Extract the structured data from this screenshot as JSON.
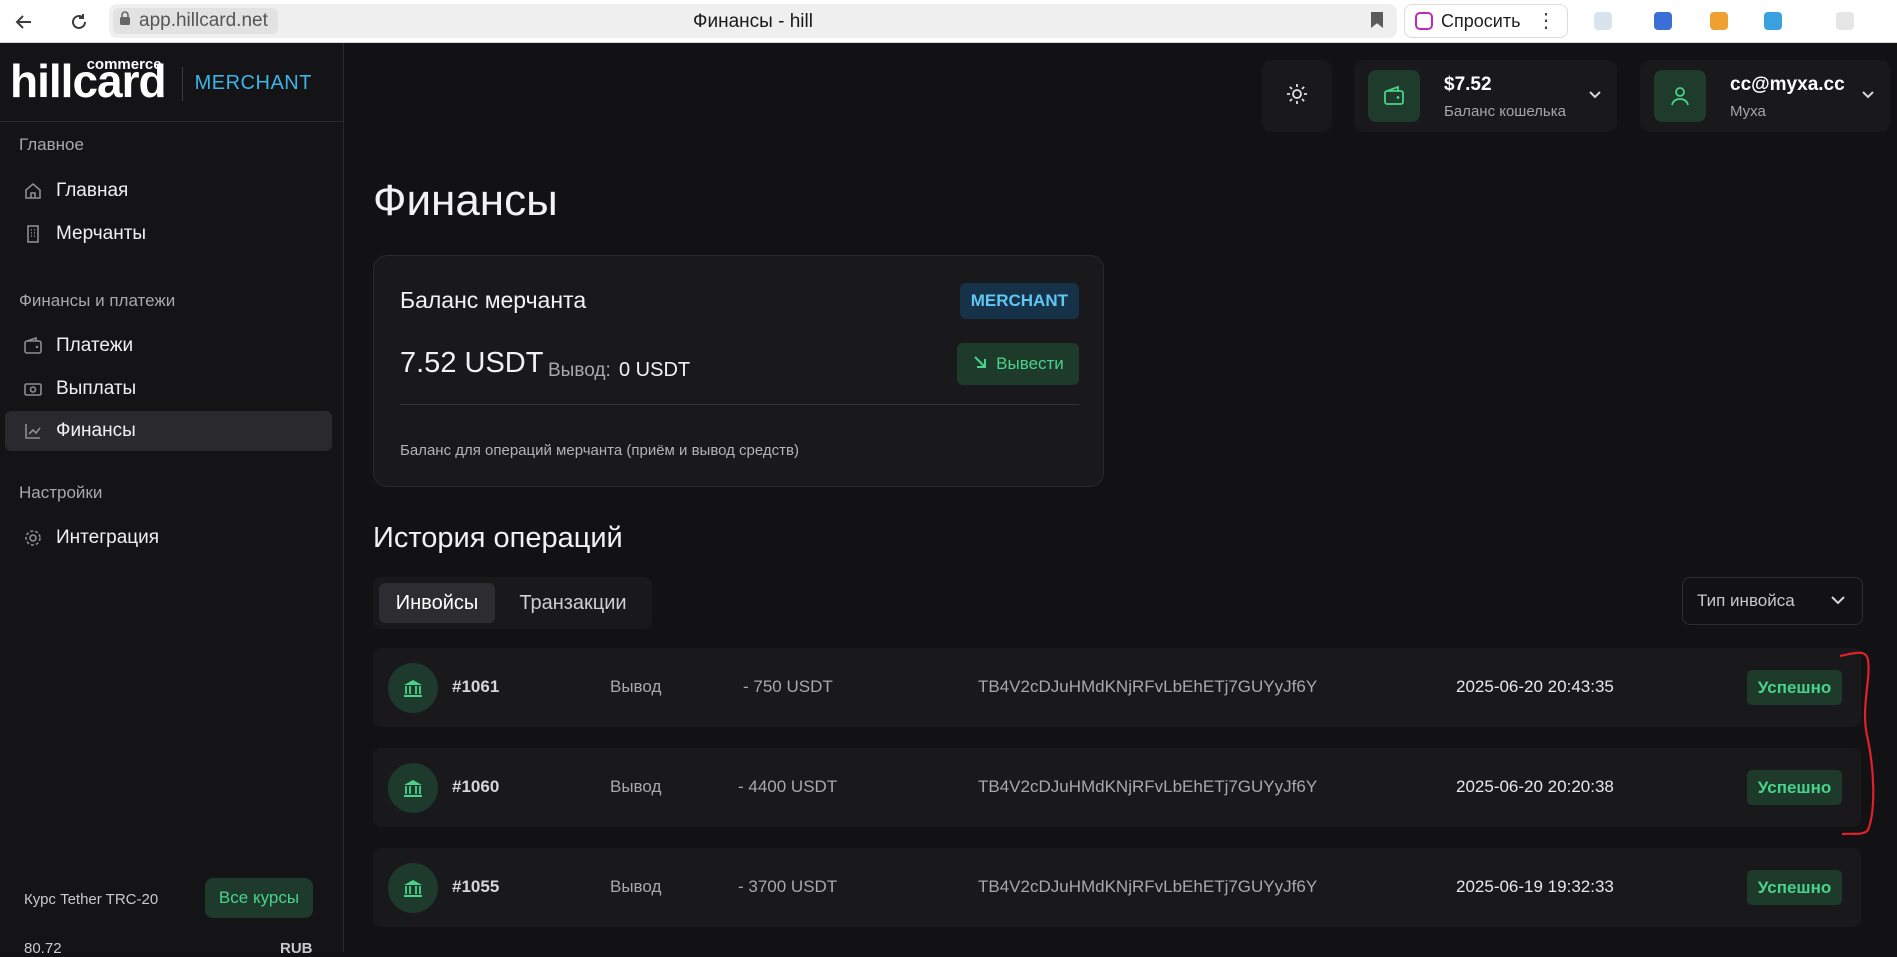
{
  "browser": {
    "url": "app.hillcard.net",
    "page_title": "Финансы - hill",
    "ask_label": "Спросить"
  },
  "sidebar": {
    "brand": {
      "logo": "hillcard",
      "logo_sup": "commerce",
      "tag": "MERCHANT"
    },
    "sections": [
      {
        "title": "Главное",
        "items": [
          {
            "label": "Главная",
            "icon": "home-icon"
          },
          {
            "label": "Мерчанты",
            "icon": "building-icon"
          }
        ]
      },
      {
        "title": "Финансы и платежи",
        "items": [
          {
            "label": "Платежи",
            "icon": "wallet-icon"
          },
          {
            "label": "Выплаты",
            "icon": "cash-icon"
          },
          {
            "label": "Финансы",
            "icon": "chart-line-icon",
            "active": true
          }
        ]
      },
      {
        "title": "Настройки",
        "items": [
          {
            "label": "Интеграция",
            "icon": "gear-icon"
          }
        ]
      }
    ],
    "rate": {
      "label": "Курс Tether TRC-20",
      "button": "Все курсы",
      "value": "80.72",
      "currency": "RUB"
    }
  },
  "header": {
    "wallet": {
      "amount": "$7.52",
      "label": "Баланс кошелька"
    },
    "user": {
      "email": "cc@myxa.cc",
      "name": "Муха"
    }
  },
  "main": {
    "title": "Финансы",
    "balance_card": {
      "title": "Баланс мерчанта",
      "badge": "MERCHANT",
      "amount": "7.52 USDT",
      "withdraw_label": "Вывод:",
      "withdraw_value": "0 USDT",
      "withdraw_button": "Вывести",
      "note": "Баланс для операций мерчанта (приём и вывод средств)"
    },
    "history": {
      "title": "История операций",
      "tabs": [
        {
          "label": "Инвойсы",
          "active": true
        },
        {
          "label": "Транзакции",
          "active": false
        }
      ],
      "filter_label": "Тип инвойса",
      "rows": [
        {
          "id": "#1061",
          "type": "Вывод",
          "amount": "- 750 USDT",
          "address": "TB4V2cDJuHMdKNjRFvLbEhETj7GUYyJf6Y",
          "date": "2025-06-20 20:43:35",
          "status": "Успешно"
        },
        {
          "id": "#1060",
          "type": "Вывод",
          "amount": "- 4400 USDT",
          "address": "TB4V2cDJuHMdKNjRFvLbEhETj7GUYyJf6Y",
          "date": "2025-06-20 20:20:38",
          "status": "Успешно"
        },
        {
          "id": "#1055",
          "type": "Вывод",
          "amount": "- 3700 USDT",
          "address": "TB4V2cDJuHMdKNjRFvLbEhETj7GUYyJf6Y",
          "date": "2025-06-19 19:32:33",
          "status": "Успешно"
        }
      ]
    }
  },
  "colors": {
    "accent_green": "#49d38a",
    "accent_blue": "#3fb2e6",
    "background": "#121214",
    "annotation_red": "#e0202a"
  }
}
